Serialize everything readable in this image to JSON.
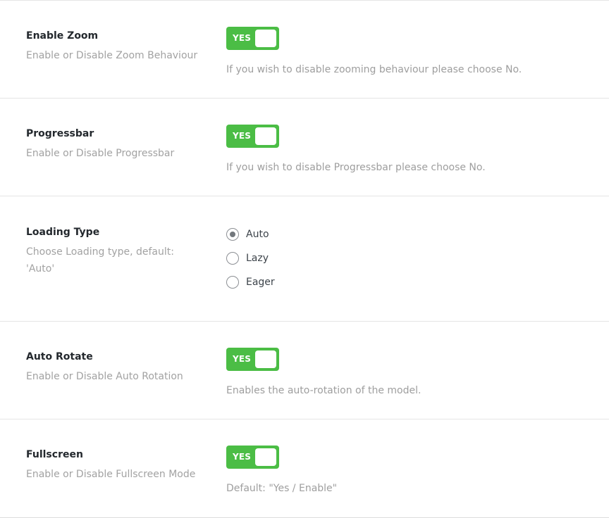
{
  "settings": {
    "zoom": {
      "title": "Enable Zoom",
      "subtitle": "Enable or Disable Zoom Behaviour",
      "toggle_label": "YES",
      "description": "If you wish to disable zooming behaviour please choose No."
    },
    "progressbar": {
      "title": "Progressbar",
      "subtitle": "Enable or Disable Progressbar",
      "toggle_label": "YES",
      "description": "If you wish to disable Progressbar please choose No."
    },
    "loading": {
      "title": "Loading Type",
      "subtitle_line1": "Choose Loading type, default:",
      "subtitle_line2": "'Auto'",
      "selected": "Auto",
      "options": [
        "Auto",
        "Lazy",
        "Eager"
      ]
    },
    "auto_rotate": {
      "title": "Auto Rotate",
      "subtitle": "Enable or Disable Auto Rotation",
      "toggle_label": "YES",
      "description": "Enables the auto-rotation of the model."
    },
    "fullscreen": {
      "title": "Fullscreen",
      "subtitle": "Enable or Disable Fullscreen Mode",
      "toggle_label": "YES",
      "description": "Default: \"Yes / Enable\""
    }
  },
  "colors": {
    "toggle_on": "#4bbd45",
    "muted_text": "#a2a2a2",
    "divider": "#e5e5e5"
  }
}
